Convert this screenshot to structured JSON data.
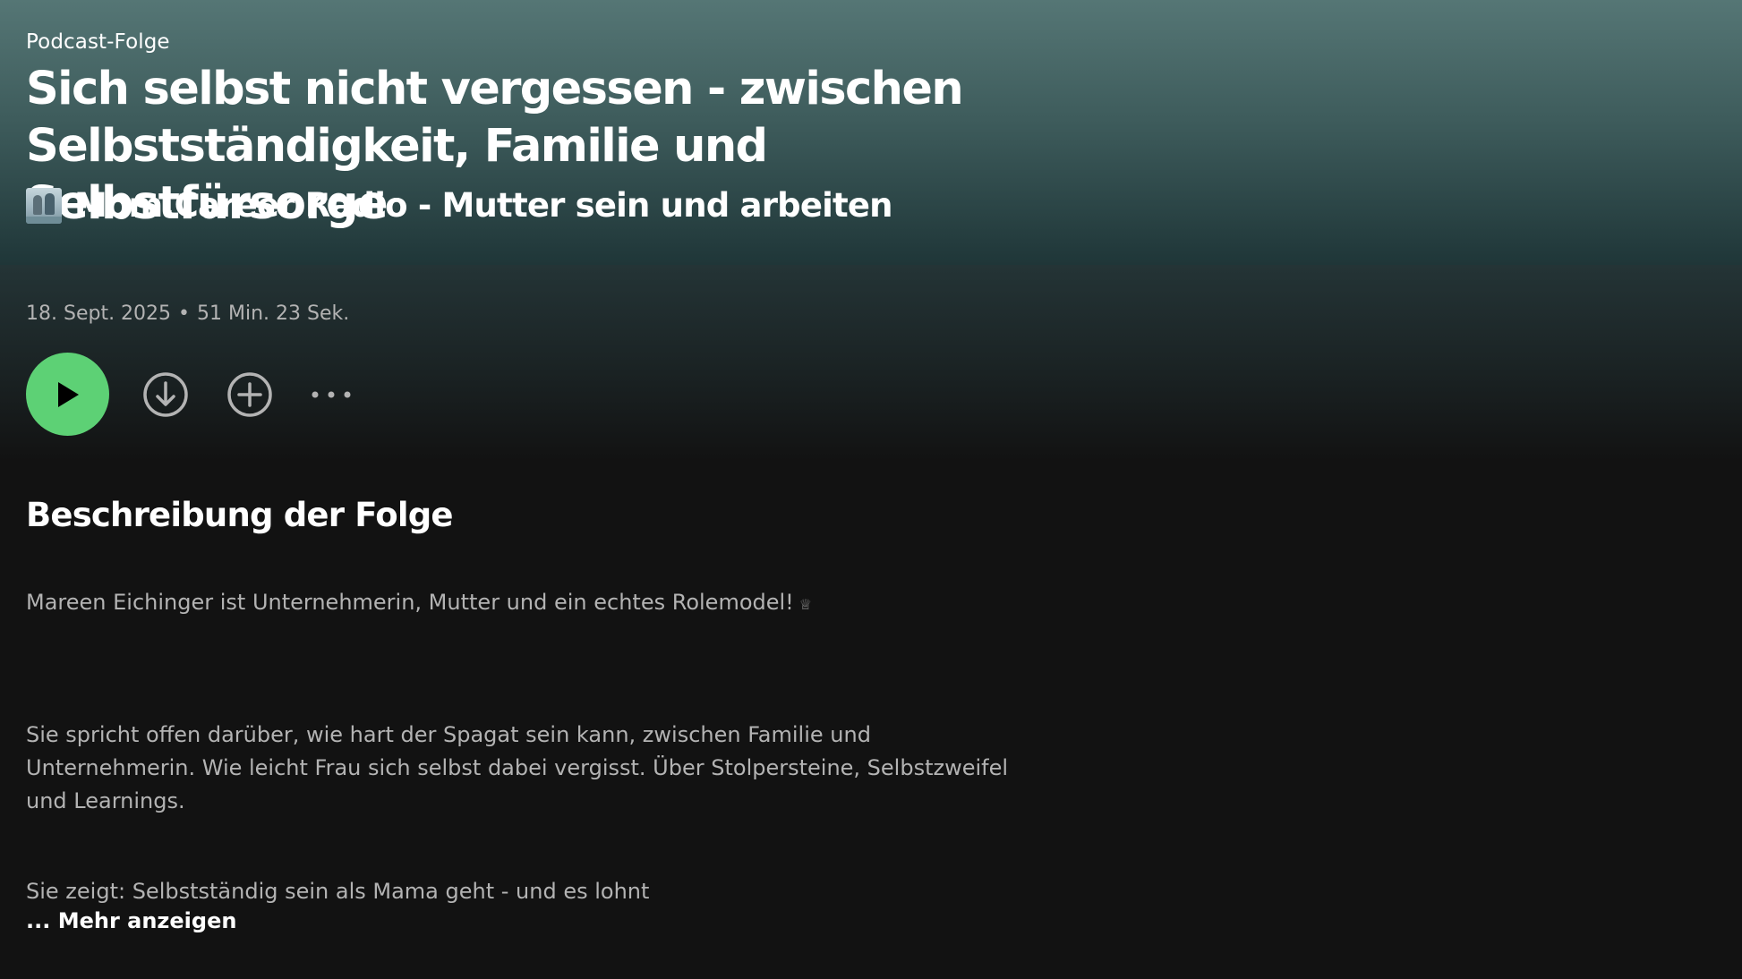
{
  "episode": {
    "kicker": "Podcast-Folge",
    "title": "Sich selbst nicht vergessen - zwischen Selbstständigkeit, Familie und Selbstfürsorge",
    "show_name": "Mom.Career Radio - Mutter sein und arbeiten",
    "date": "18. Sept. 2025",
    "separator": "•",
    "duration": "51 Min. 23 Sek."
  },
  "actions": {
    "play_icon": "play-icon",
    "download_icon": "download-icon",
    "add_icon": "add-icon",
    "more_icon": "more-options-icon"
  },
  "description": {
    "heading": "Beschreibung der Folge",
    "paragraph_1": "Mareen Eichinger ist Unternehmerin, Mutter und ein echtes Rolemodel!",
    "paragraph_1_glyph": "♕",
    "paragraph_2": "Sie spricht offen darüber, wie hart der Spagat sein kann, zwischen Familie und Unternehmerin. Wie leicht Frau sich selbst dabei vergisst. Über Stolpersteine, Selbstzweifel und Learnings.",
    "paragraph_3": "Sie zeigt: Selbstständig sein als Mama geht - und es lohnt",
    "show_more": "... Mehr anzeigen"
  },
  "colors": {
    "accent_green": "#5dd175",
    "header_top": "#557675",
    "background": "#121212",
    "muted_text": "#b3b3b3"
  }
}
